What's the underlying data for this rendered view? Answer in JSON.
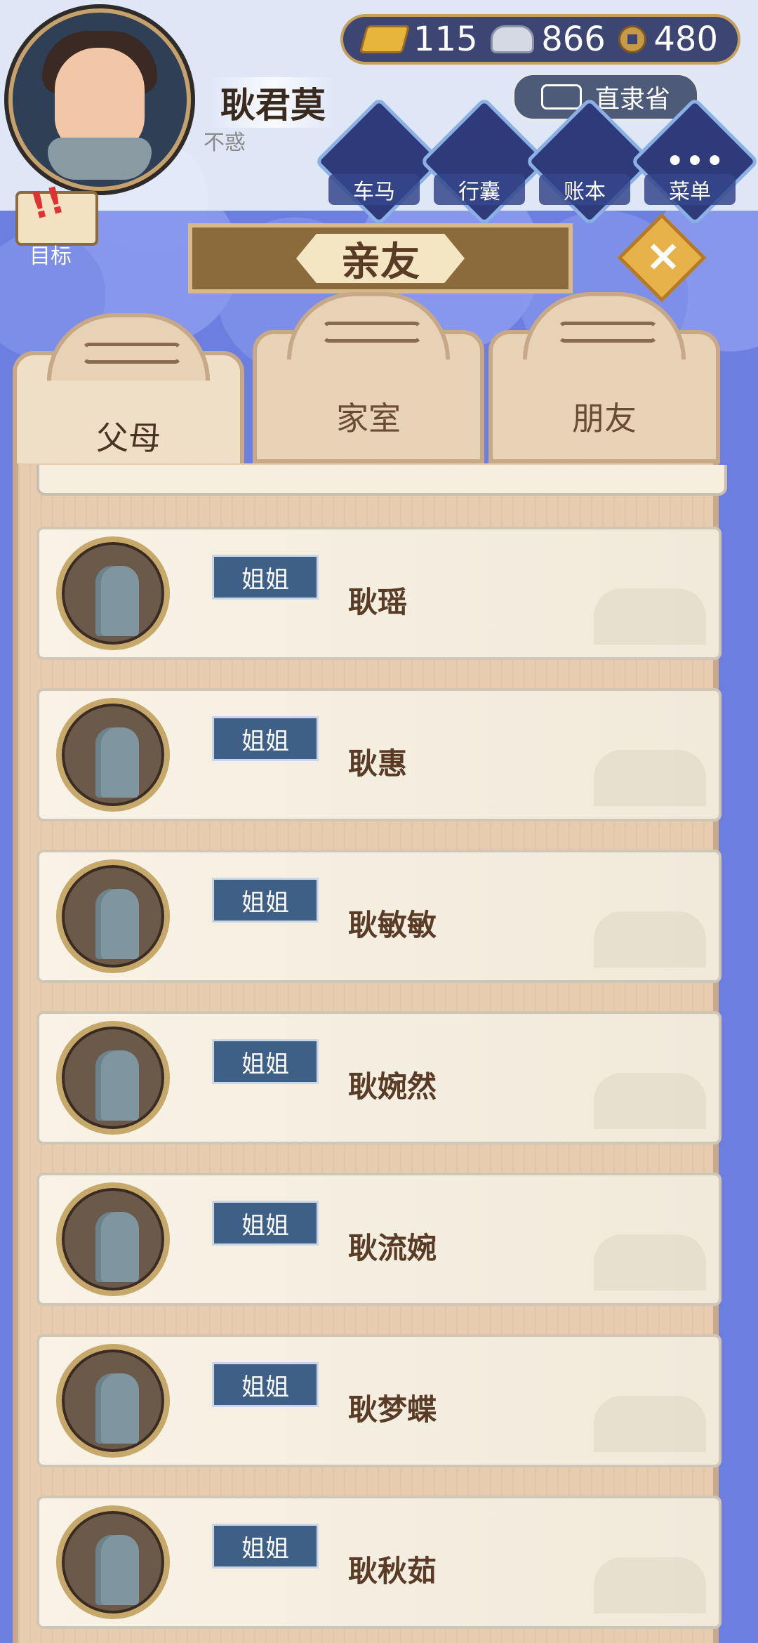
{
  "player": {
    "name": "耿君莫",
    "age_title": "不惑"
  },
  "currency": {
    "gold": "115",
    "silver": "866",
    "coins": "480"
  },
  "location": {
    "name": "直隶省"
  },
  "menu": {
    "carriage": "车马",
    "bag": "行囊",
    "ledger": "账本",
    "menu": "菜单"
  },
  "goal": {
    "label": "目标"
  },
  "title": "亲友",
  "tabs": [
    "父母",
    "家室",
    "朋友"
  ],
  "relatives": [
    {
      "relation": "姐姐",
      "name": "耿瑶"
    },
    {
      "relation": "姐姐",
      "name": "耿惠"
    },
    {
      "relation": "姐姐",
      "name": "耿敏敏"
    },
    {
      "relation": "姐姐",
      "name": "耿婉然"
    },
    {
      "relation": "姐姐",
      "name": "耿流婉"
    },
    {
      "relation": "姐姐",
      "name": "耿梦蝶"
    },
    {
      "relation": "姐姐",
      "name": "耿秋茹"
    }
  ],
  "colors": {
    "panel": "#e8ccb0",
    "badge": "#3e5f86",
    "accent": "#c6a15d",
    "sky": "#6c7ee0"
  }
}
